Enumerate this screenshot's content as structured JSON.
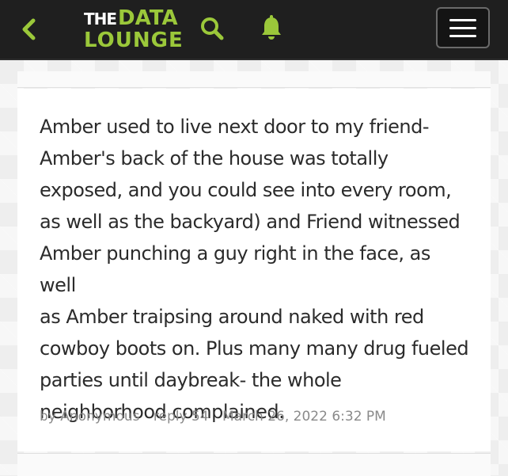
{
  "header": {
    "logo_top_small": "THE",
    "logo_top_big": "DATA",
    "logo_bottom": "LOUNGE",
    "back_icon": "chevron-left-icon",
    "search_icon": "search-icon",
    "bell_icon": "bell-icon",
    "menu_icon": "hamburger-menu-icon",
    "accent_color": "#9bc83a",
    "bar_color": "#1f1f1f"
  },
  "post": {
    "lines": [
      "Amber used to live next door to my friend-",
      "Amber's back of the house was totally",
      "exposed, and you could see into every room,",
      "as well as the backyard) and Friend witnessed",
      "Amber punching a guy right in the face, as well",
      "as Amber traipsing around naked with red",
      "cowboy boots on. Plus many many drug fueled",
      "parties until daybreak- the whole",
      "neighborhood complained."
    ],
    "author": "by Anonymous",
    "reply": "reply 54",
    "timestamp": "March 26, 2022 6:32 PM"
  }
}
